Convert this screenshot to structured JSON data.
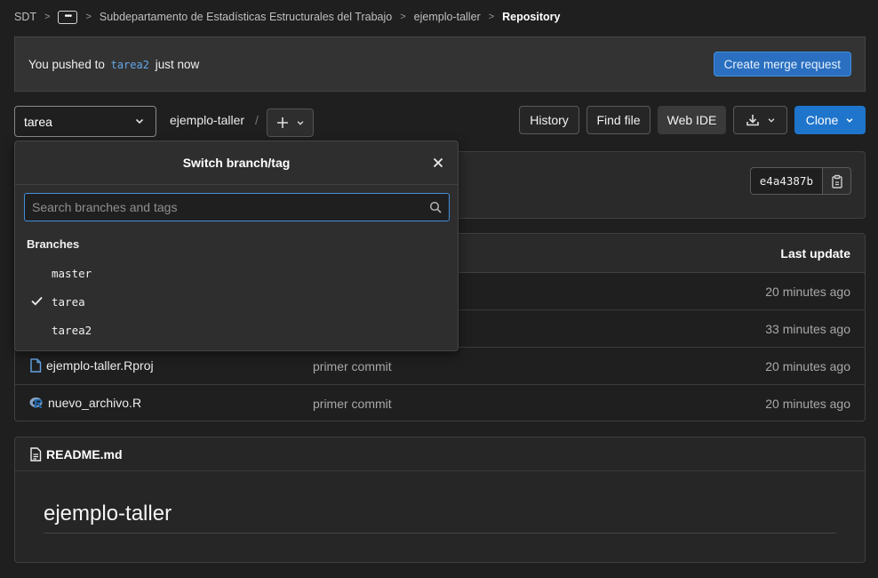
{
  "breadcrumb": {
    "root": "SDT",
    "more": "•••",
    "group": "Subdepartamento de Estadísticas Estructurales del Trabajo",
    "project": "ejemplo-taller",
    "current": "Repository"
  },
  "alert": {
    "prefix": "You pushed to",
    "branch": "tarea2",
    "suffix": "just now",
    "button": "Create merge request"
  },
  "toolbar": {
    "branch": "tarea",
    "project": "ejemplo-taller",
    "slash": "/",
    "history": "History",
    "find_file": "Find file",
    "web_ide": "Web IDE",
    "clone": "Clone"
  },
  "commit": {
    "sha": "e4a4387b"
  },
  "files": {
    "header_update": "Last update",
    "rows": [
      {
        "name": "",
        "commit": "",
        "update": "20 minutes ago",
        "icon": ""
      },
      {
        "name": "",
        "commit": "",
        "update": "33 minutes ago",
        "icon": ""
      },
      {
        "name": "ejemplo-taller.Rproj",
        "commit": "primer commit",
        "update": "20 minutes ago",
        "icon": "file-icon"
      },
      {
        "name": "nuevo_archivo.R",
        "commit": "primer commit",
        "update": "20 minutes ago",
        "icon": "r-language-icon"
      }
    ]
  },
  "readme": {
    "filename": "README.md",
    "title": "ejemplo-taller"
  },
  "dropdown": {
    "title": "Switch branch/tag",
    "search_placeholder": "Search branches and tags",
    "section": "Branches",
    "items": [
      {
        "label": "master",
        "selected": false
      },
      {
        "label": "tarea",
        "selected": true
      },
      {
        "label": "tarea2",
        "selected": false
      }
    ]
  },
  "colors": {
    "background": "#1f1f1f",
    "primary": "#1f75cb",
    "link": "#63a6e9"
  }
}
